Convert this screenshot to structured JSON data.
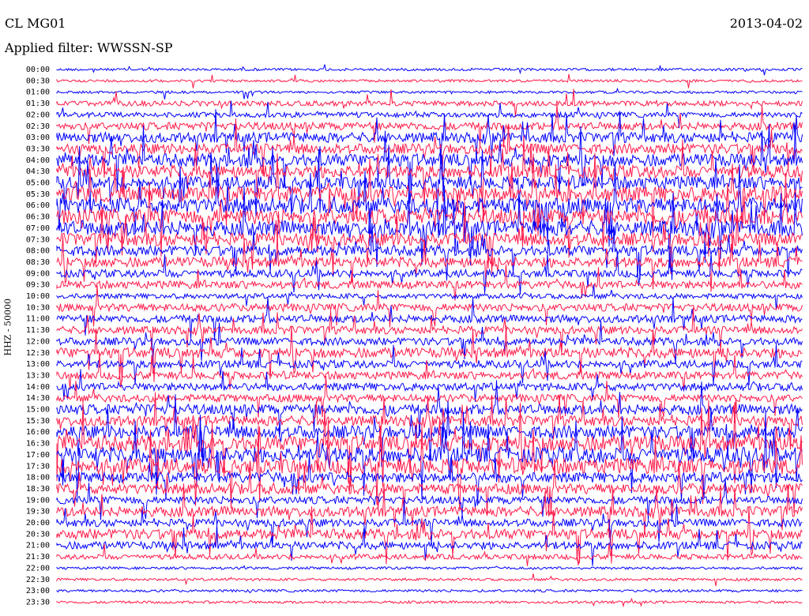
{
  "header": {
    "station": "CL MG01",
    "filter": "Applied filter: WWSSN-SP",
    "date": "2013-04-02"
  },
  "chart_data": {
    "type": "line",
    "title": "CL MG01",
    "subtitle": "Applied filter: WWSSN-SP",
    "ylabel": "HHZ - 50000",
    "xlabel": "",
    "colors": {
      "series_a": "#0000ff",
      "series_b": "#ff1a4a"
    },
    "row_labels": [
      "00:00",
      "00:30",
      "01:00",
      "01:30",
      "02:00",
      "02:30",
      "03:00",
      "03:30",
      "04:00",
      "04:30",
      "05:00",
      "05:30",
      "06:00",
      "06:30",
      "07:00",
      "07:30",
      "08:00",
      "08:30",
      "09:00",
      "09:30",
      "10:00",
      "10:30",
      "11:00",
      "11:30",
      "12:00",
      "12:30",
      "13:00",
      "13:30",
      "14:00",
      "14:30",
      "15:00",
      "15:30",
      "16:00",
      "16:30",
      "17:00",
      "17:30",
      "18:00",
      "18:30",
      "19:00",
      "19:30",
      "20:00",
      "20:30",
      "21:00",
      "21:30",
      "22:00",
      "22:30",
      "23:00",
      "23:30"
    ],
    "row_amplitude": [
      1,
      1,
      1,
      2,
      2,
      3,
      4,
      4,
      5,
      5,
      5,
      6,
      6,
      6,
      6,
      5,
      4,
      4,
      3,
      3,
      2,
      3,
      3,
      3,
      3,
      4,
      3,
      3,
      3,
      3,
      4,
      4,
      5,
      6,
      6,
      6,
      4,
      4,
      3,
      4,
      3,
      4,
      3,
      2,
      1,
      1,
      1,
      1
    ]
  }
}
